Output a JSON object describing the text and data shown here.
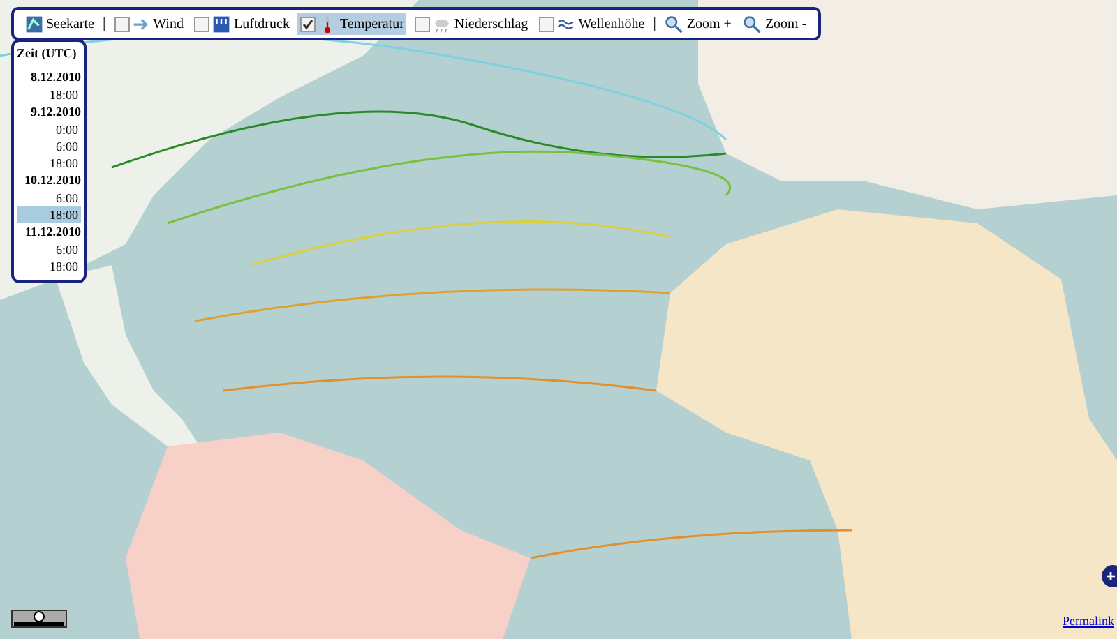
{
  "toolbar": {
    "items": [
      {
        "kind": "button",
        "label": "Seekarte"
      },
      {
        "kind": "separator",
        "label": "|"
      },
      {
        "kind": "layer",
        "label": "Wind",
        "checked": false
      },
      {
        "kind": "layer",
        "label": "Luftdruck",
        "checked": false
      },
      {
        "kind": "layer",
        "label": "Temperatur",
        "checked": true
      },
      {
        "kind": "layer",
        "label": "Niederschlag",
        "checked": false
      },
      {
        "kind": "layer",
        "label": "Wellenhöhe",
        "checked": false
      },
      {
        "kind": "separator",
        "label": "|"
      },
      {
        "kind": "zoom",
        "label": "Zoom +"
      },
      {
        "kind": "zoom",
        "label": "Zoom -"
      }
    ]
  },
  "time_panel": {
    "title": "Zeit (UTC)",
    "entries": [
      {
        "kind": "date",
        "label": "8.12.2010"
      },
      {
        "kind": "time",
        "label": "18:00",
        "selected": false
      },
      {
        "kind": "date",
        "label": "9.12.2010"
      },
      {
        "kind": "time",
        "label": "0:00",
        "selected": false
      },
      {
        "kind": "time",
        "label": "6:00",
        "selected": false
      },
      {
        "kind": "time",
        "label": "18:00",
        "selected": false
      },
      {
        "kind": "date",
        "label": "10.12.2010"
      },
      {
        "kind": "time",
        "label": "6:00",
        "selected": false
      },
      {
        "kind": "time",
        "label": "18:00",
        "selected": true
      },
      {
        "kind": "date",
        "label": "11.12.2010"
      },
      {
        "kind": "time",
        "label": "6:00",
        "selected": false
      },
      {
        "kind": "time",
        "label": "18:00",
        "selected": false
      }
    ]
  },
  "map_controls": {
    "expand_button": "+",
    "permalink": "Permalink"
  }
}
